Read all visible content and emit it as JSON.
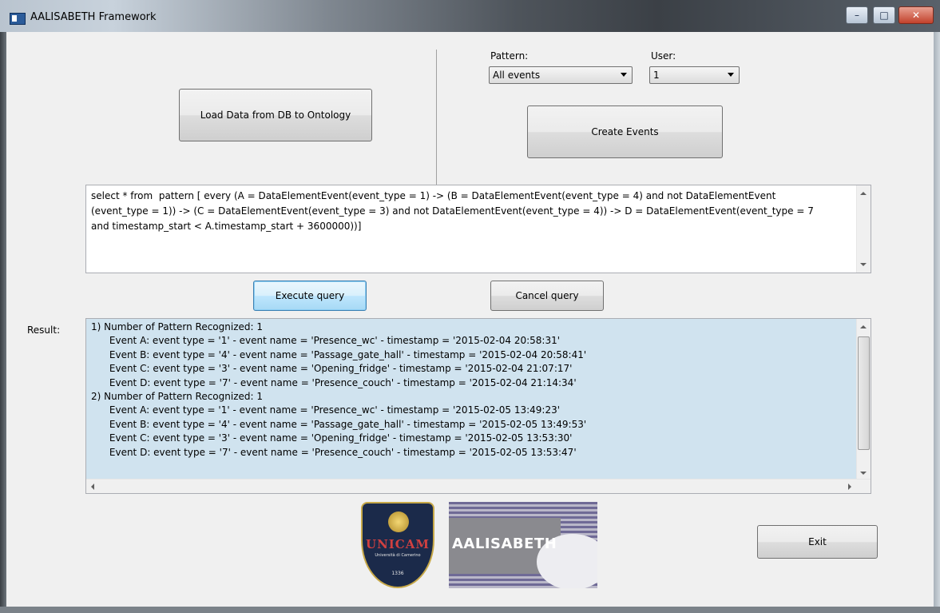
{
  "window": {
    "title": "AALISABETH Framework",
    "controls": {
      "minimize": "–",
      "maximize": "□",
      "close": "✕"
    }
  },
  "top_left": {
    "load_button": "Load Data from DB to Ontology"
  },
  "filters": {
    "pattern_label": "Pattern:",
    "pattern_value": "All events",
    "user_label": "User:",
    "user_value": "1"
  },
  "create_button": "Create Events",
  "query": {
    "text": "select * from  pattern [ every (A = DataElementEvent(event_type = 1) -> (B = DataElementEvent(event_type = 4) and not DataElementEvent\n(event_type = 1)) -> (C = DataElementEvent(event_type = 3) and not DataElementEvent(event_type = 4)) -> D = DataElementEvent(event_type = 7\nand timestamp_start < A.timestamp_start + 3600000))]"
  },
  "actions": {
    "execute": "Execute query",
    "cancel": "Cancel query"
  },
  "result": {
    "label": "Result:",
    "lines": [
      "1) Number of Pattern Recognized: 1",
      "      Event A: event type = '1' - event name = 'Presence_wc' - timestamp = '2015-02-04 20:58:31'",
      "      Event B: event type = '4' - event name = 'Passage_gate_hall' - timestamp = '2015-02-04 20:58:41'",
      "      Event C: event type = '3' - event name = 'Opening_fridge' - timestamp = '2015-02-04 21:07:17'",
      "      Event D: event type = '7' - event name = 'Presence_couch' - timestamp = '2015-02-04 21:14:34'",
      "2) Number of Pattern Recognized: 1",
      "      Event A: event type = '1' - event name = 'Presence_wc' - timestamp = '2015-02-05 13:49:23'",
      "      Event B: event type = '4' - event name = 'Passage_gate_hall' - timestamp = '2015-02-05 13:49:53'",
      "      Event C: event type = '3' - event name = 'Opening_fridge' - timestamp = '2015-02-05 13:53:30'",
      "      Event D: event type = '7' - event name = 'Presence_couch' - timestamp = '2015-02-05 13:53:47'"
    ]
  },
  "logos": {
    "unicam_name": "UNICAM",
    "unicam_sub": "Università di Camerino",
    "unicam_year": "1336",
    "aalisabeth": "AALISABETH"
  },
  "exit_button": "Exit"
}
